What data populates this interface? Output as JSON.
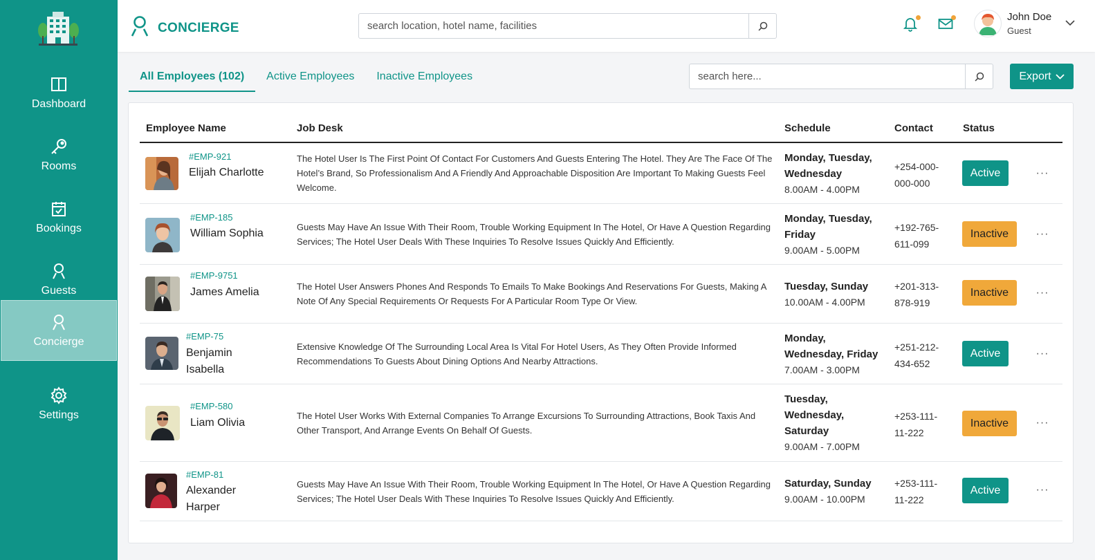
{
  "app": {
    "title": "CONCIERGE"
  },
  "sidebar": {
    "items": [
      {
        "label": "Dashboard",
        "icon": "book-open-icon"
      },
      {
        "label": "Rooms",
        "icon": "key-icon"
      },
      {
        "label": "Bookings",
        "icon": "calendar-check-icon"
      },
      {
        "label": "Guests",
        "icon": "user-icon"
      },
      {
        "label": "Concierge",
        "icon": "user-icon",
        "active": true
      },
      {
        "label": "Settings",
        "icon": "gear-icon"
      }
    ]
  },
  "header": {
    "search_placeholder": "search location, hotel name, facilities",
    "user": {
      "name": "John Doe",
      "role": "Guest"
    },
    "notification_badge": true,
    "mail_badge": true
  },
  "tabs": [
    {
      "label": "All Employees (102)",
      "active": true
    },
    {
      "label": "Active Employees",
      "active": false
    },
    {
      "label": "Inactive Employees",
      "active": false
    }
  ],
  "employee_search_placeholder": "search here...",
  "export_label": "Export",
  "table": {
    "headers": [
      "Employee Name",
      "Job Desk",
      "Schedule",
      "Contact",
      "Status"
    ],
    "rows": [
      {
        "id": "#EMP-921",
        "name": "Elijah Charlotte",
        "job": "The Hotel User Is The First Point Of Contact For Customers And Guests Entering The Hotel. They Are The Face Of The Hotel’s Brand, So Professionalism And A Friendly And Approachable Disposition Are Important To Making Guests Feel Welcome.",
        "days": "Monday, Tuesday, Wednesday",
        "time": "8.00AM - 4.00PM",
        "contact": "+254-000-000-000",
        "status": "Active"
      },
      {
        "id": "#EMP-185",
        "name": "William Sophia",
        "job": "Guests May Have An Issue With Their Room, Trouble Working Equipment In The Hotel, Or Have A Question Regarding Services; The Hotel User Deals With These Inquiries To Resolve Issues Quickly And Efficiently.",
        "days": "Monday, Tuesday, Friday",
        "time": "9.00AM - 5.00PM",
        "contact": "+192-765-611-099",
        "status": "Inactive"
      },
      {
        "id": "#EMP-9751",
        "name": "James Amelia",
        "job": "The Hotel User Answers Phones And Responds To Emails To Make Bookings And Reservations For Guests, Making A Note Of Any Special Requirements Or Requests For A Particular Room Type Or View.",
        "days": "Tuesday, Sunday",
        "time": "10.00AM - 4.00PM",
        "contact": "+201-313-878-919",
        "status": "Inactive"
      },
      {
        "id": "#EMP-75",
        "name": "Benjamin Isabella",
        "job": "Extensive Knowledge Of The Surrounding Local Area Is Vital For Hotel Users, As They Often Provide Informed Recommendations To Guests About Dining Options And Nearby Attractions.",
        "days": "Monday, Wednesday, Friday",
        "time": "7.00AM - 3.00PM",
        "contact": "+251-212-434-652",
        "status": "Active"
      },
      {
        "id": "#EMP-580",
        "name": "Liam Olivia",
        "job": "The Hotel User Works With External Companies To Arrange Excursions To Surrounding Attractions, Book Taxis And Other Transport, And Arrange Events On Behalf Of Guests.",
        "days": "Tuesday, Wednesday, Saturday",
        "time": "9.00AM - 7.00PM",
        "contact": "+253-111-11-222",
        "status": "Inactive"
      },
      {
        "id": "#EMP-81",
        "name": "Alexander Harper",
        "job": "Guests May Have An Issue With Their Room, Trouble Working Equipment In The Hotel, Or Have A Question Regarding Services; The Hotel User Deals With These Inquiries To Resolve Issues Quickly And Efficiently.",
        "days": "Saturday, Sunday",
        "time": "9.00AM - 10.00PM",
        "contact": "+253-111-11-222",
        "status": "Active"
      }
    ]
  },
  "colors": {
    "primary": "#0f9488",
    "sidebar_active": "#85c9c3",
    "active": "#0f9488",
    "inactive": "#f0a83a",
    "badge": "#f0a43a"
  }
}
